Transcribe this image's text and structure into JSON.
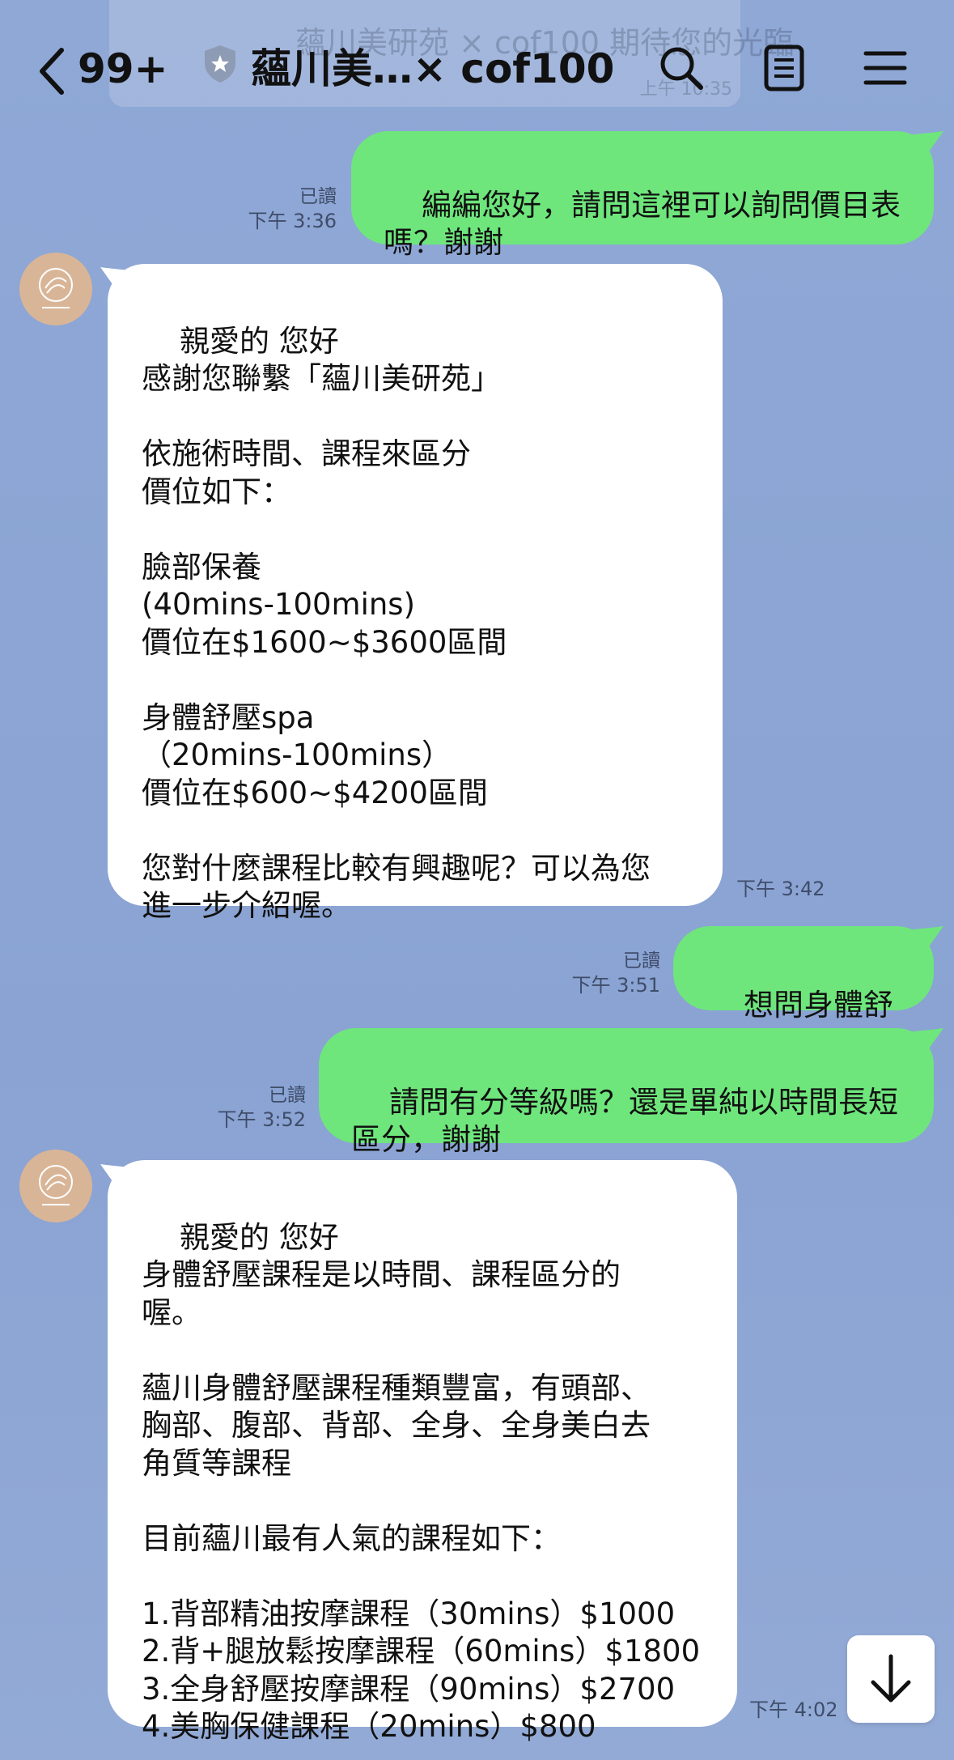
{
  "pinned": {
    "text": "蘊川美研苑 × cof100 期待您的光臨",
    "time": "上午 10:35"
  },
  "header": {
    "unread": "99+",
    "title": "蘊川美…× cof100"
  },
  "icons": {
    "back": "chevron-left-icon",
    "verified": "shield-icon",
    "search": "search-icon",
    "notes": "notes-icon",
    "menu": "hamburger-menu-icon",
    "scroll": "arrow-down-icon"
  },
  "colors": {
    "background": "#8aa3d3",
    "outgoing_bubble": "#6ee67c",
    "incoming_bubble": "#ffffff"
  },
  "messages": [
    {
      "direction": "out",
      "text": "編編您好，請問這裡可以詢問價目表\n嗎？謝謝",
      "read": "已讀",
      "time": "下午 3:36"
    },
    {
      "direction": "in",
      "text": "親愛的 您好\n感謝您聯繫「蘊川美研苑」\n\n依施術時間、課程來區分\n價位如下：\n\n臉部保養\n(40mins-100mins)\n價位在$1600~$3600區間\n\n身體舒壓spa\n（20mins-100mins）\n價位在$600~$4200區間\n\n您對什麼課程比較有興趣呢？可以為您\n進一步介紹喔。",
      "time": "下午 3:42"
    },
    {
      "direction": "out",
      "text": "想問身體舒壓",
      "read": "已讀",
      "time": "下午 3:51"
    },
    {
      "direction": "out",
      "text": "請問有分等級嗎？還是單純以時間長短\n區分，謝謝",
      "read": "已讀",
      "time": "下午 3:52"
    },
    {
      "direction": "in",
      "text": "親愛的 您好\n身體舒壓課程是以時間、課程區分的\n喔。\n\n蘊川身體舒壓課程種類豐富，有頭部、\n胸部、腹部、背部、全身、全身美白去\n角質等課程\n\n目前蘊川最有人氣的課程如下：\n\n1.背部精油按摩課程（30mins）$1000\n2.背+腿放鬆按摩課程（60mins）$1800\n3.全身舒壓按摩課程（90mins）$2700\n4.美胸保健課程（20mins）$800",
      "time": "下午 4:02"
    }
  ]
}
